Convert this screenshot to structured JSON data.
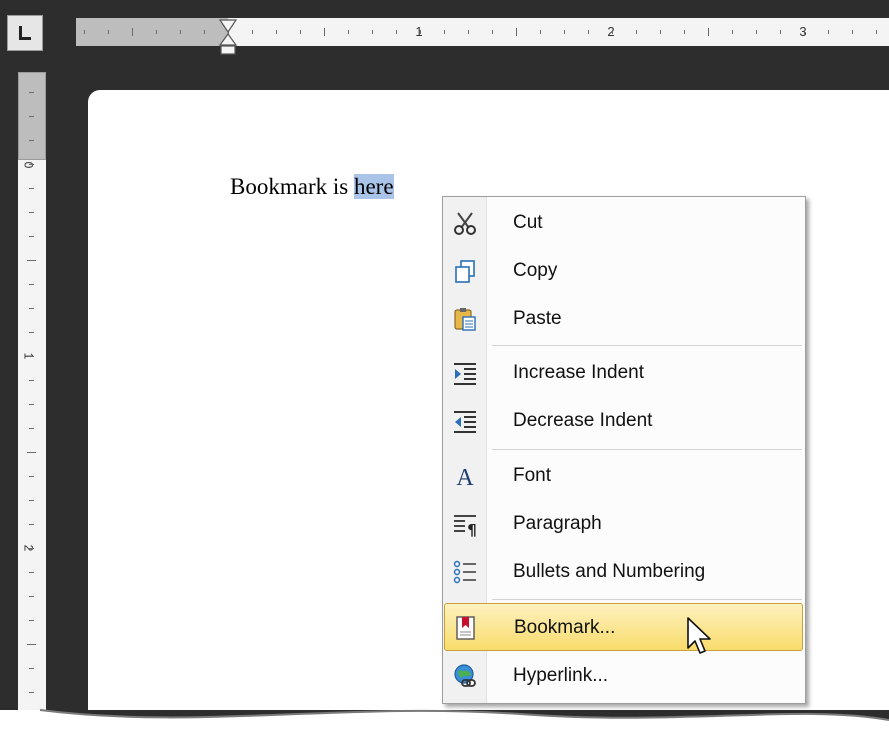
{
  "document": {
    "text_before": "Bookmark is ",
    "text_selected": "here"
  },
  "ruler": {
    "numbers": [
      "1",
      "2",
      "3"
    ],
    "vertical_numbers": [
      "0",
      "1",
      "2"
    ]
  },
  "context_menu": {
    "items": [
      {
        "label": "Cut",
        "icon": "scissors-icon"
      },
      {
        "label": "Copy",
        "icon": "copy-icon"
      },
      {
        "label": "Paste",
        "icon": "paste-icon"
      },
      {
        "label": "Increase Indent",
        "icon": "increase-indent-icon"
      },
      {
        "label": "Decrease Indent",
        "icon": "decrease-indent-icon"
      },
      {
        "label": "Font",
        "icon": "font-icon"
      },
      {
        "label": "Paragraph",
        "icon": "paragraph-icon"
      },
      {
        "label": "Bullets and Numbering",
        "icon": "bullets-icon"
      },
      {
        "label": "Bookmark...",
        "icon": "bookmark-icon",
        "highlighted": true
      },
      {
        "label": "Hyperlink...",
        "icon": "hyperlink-icon"
      }
    ]
  },
  "colors": {
    "selection": "#a9c4e8",
    "highlight_top": "#fdf1bf",
    "highlight_bottom": "#f9dc6c",
    "frame": "#2d2d2d"
  }
}
